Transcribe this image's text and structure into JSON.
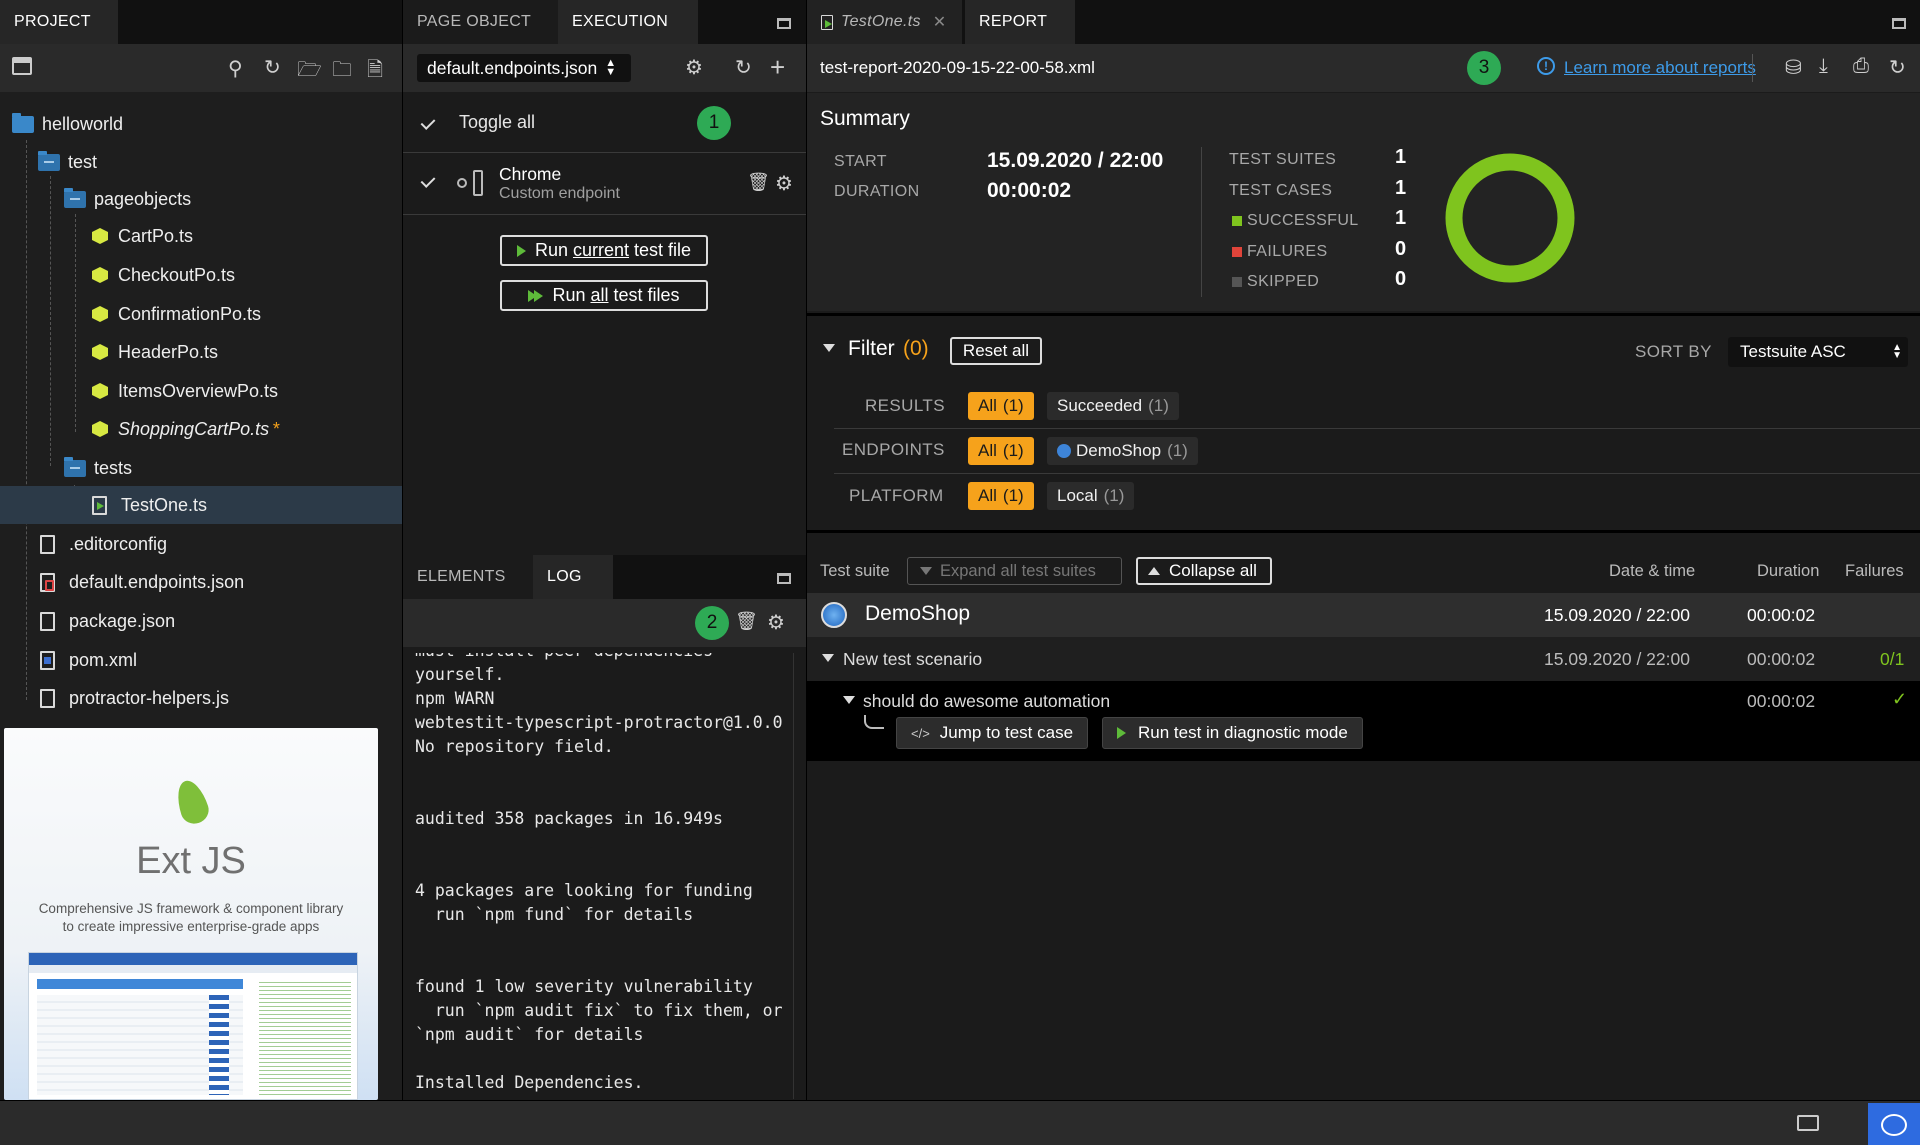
{
  "project": {
    "tab": "PROJECT",
    "tree": [
      {
        "label": "helloworld",
        "kind": "root-folder"
      },
      {
        "label": "test",
        "kind": "folder"
      },
      {
        "label": "pageobjects",
        "kind": "folder"
      },
      {
        "label": "CartPo.ts",
        "kind": "po"
      },
      {
        "label": "CheckoutPo.ts",
        "kind": "po"
      },
      {
        "label": "ConfirmationPo.ts",
        "kind": "po"
      },
      {
        "label": "HeaderPo.ts",
        "kind": "po"
      },
      {
        "label": "ItemsOverviewPo.ts",
        "kind": "po"
      },
      {
        "label": "ShoppingCartPo.ts",
        "kind": "po",
        "modified": "*"
      },
      {
        "label": "tests",
        "kind": "folder"
      },
      {
        "label": "TestOne.ts",
        "kind": "test"
      },
      {
        "label": ".editorconfig",
        "kind": "file"
      },
      {
        "label": "default.endpoints.json",
        "kind": "json"
      },
      {
        "label": "package.json",
        "kind": "file"
      },
      {
        "label": "pom.xml",
        "kind": "xml"
      },
      {
        "label": "protractor-helpers.js",
        "kind": "file"
      }
    ],
    "ad": {
      "brand": "Ext JS",
      "line1": "Comprehensive JS framework & component library",
      "line2": "to create impressive enterprise-grade apps"
    }
  },
  "execution": {
    "tabs": [
      "PAGE OBJECT",
      "EXECUTION"
    ],
    "endpoints_select": "default.endpoints.json",
    "toggle_all": "Toggle all",
    "badge1": "1",
    "endpoint_name": "Chrome",
    "endpoint_sub": "Custom endpoint",
    "run_current": {
      "pre": "Run ",
      "u": "current",
      "post": " test file"
    },
    "run_all": {
      "pre": "Run ",
      "u": "all",
      "post": " test files"
    }
  },
  "log": {
    "tabs": [
      "ELEMENTS",
      "LOG"
    ],
    "badge2": "2",
    "lines": "must install peer dependencies\nyourself.\nnpm WARN\nwebtestit-typescript-protractor@1.0.0\nNo repository field.\n\n\naudited 358 packages in 16.949s\n\n\n4 packages are looking for funding\n  run `npm fund` for details\n\n\nfound 1 low severity vulnerability\n  run `npm audit fix` to fix them, or\n`npm audit` for details\n\nInstalled Dependencies."
  },
  "report": {
    "tabs": [
      "TestOne.ts",
      "REPORT"
    ],
    "filename": "test-report-2020-09-15-22-00-58.xml",
    "badge3": "3",
    "learn_more": "Learn more about reports",
    "summary_title": "Summary",
    "start_label": "START",
    "start_value": "15.09.2020 / 22:00",
    "duration_label": "DURATION",
    "duration_value": "00:00:02",
    "stats": [
      {
        "label": "TEST SUITES",
        "value": "1",
        "color": ""
      },
      {
        "label": "TEST CASES",
        "value": "1",
        "color": ""
      },
      {
        "label": "SUCCESSFUL",
        "value": "1",
        "color": "#7fc41e"
      },
      {
        "label": "FAILURES",
        "value": "0",
        "color": "#e0443a"
      },
      {
        "label": "SKIPPED",
        "value": "0",
        "color": "#555555"
      }
    ],
    "donut_success_fraction": 1,
    "filter_label": "Filter",
    "filter_count": "(0)",
    "reset_all": "Reset all",
    "sort_by_label": "SORT BY",
    "sort_by_value": "Testsuite ASC",
    "filters": {
      "results": {
        "label": "RESULTS",
        "all": "All",
        "all_count": "(1)",
        "opt": "Succeeded",
        "opt_count": "(1)"
      },
      "endpoints": {
        "label": "ENDPOINTS",
        "all": "All",
        "all_count": "(1)",
        "opt": "DemoShop",
        "opt_count": "(1)"
      },
      "platform": {
        "label": "PLATFORM",
        "all": "All",
        "all_count": "(1)",
        "opt": "Local",
        "opt_count": "(1)"
      }
    },
    "table": {
      "col_suite": "Test suite",
      "expand_all": "Expand all test suites",
      "collapse_all": "Collapse all",
      "col_date": "Date & time",
      "col_duration": "Duration",
      "col_failures": "Failures",
      "suite_name": "DemoShop",
      "suite_date": "15.09.2020 / 22:00",
      "suite_duration": "00:00:02",
      "scenario_name": "New test scenario",
      "scenario_date": "15.09.2020 / 22:00",
      "scenario_duration": "00:00:02",
      "scenario_failures": "0/1",
      "case_name": "should do awesome automation",
      "case_duration": "00:00:02",
      "jump_btn": "Jump to test case",
      "diag_btn": "Run test in diagnostic mode"
    }
  },
  "colors": {
    "accent_green": "#7fc41e",
    "filter_orange": "#f6a21b",
    "badge_green": "#2eaa55",
    "link_blue": "#3d9be9"
  }
}
